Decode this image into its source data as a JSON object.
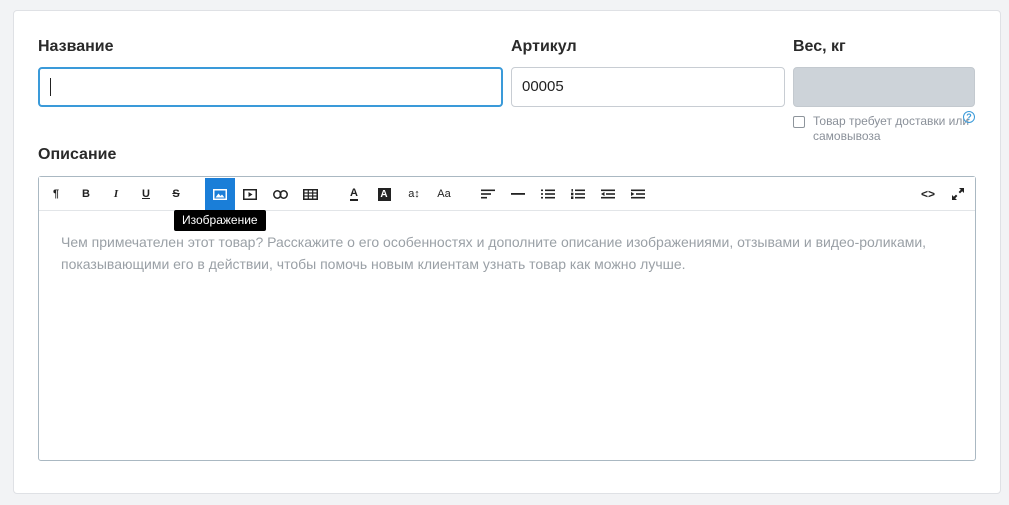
{
  "form": {
    "name": {
      "label": "Название",
      "value": ""
    },
    "sku": {
      "label": "Артикул",
      "value": "00005"
    },
    "weight": {
      "label": "Вес, кг",
      "value": ""
    },
    "delivery_checkbox": {
      "label": "Товар требует доставки или самовывоза",
      "checked": false
    },
    "help_icon": "question-circle-icon",
    "description": {
      "label": "Описание",
      "placeholder": "Чем примечателен этот товар? Расскажите о его особенностях и дополните описание изображениями, отзывами и видео-роликами, показывающими его в действии, чтобы помочь новым клиентам узнать товар как можно лучше."
    }
  },
  "toolbar": {
    "buttons": [
      {
        "icon": "paragraph-icon",
        "text": "¶"
      },
      {
        "icon": "bold-icon",
        "text": "B"
      },
      {
        "icon": "italic-icon",
        "text": "I"
      },
      {
        "icon": "underline-icon",
        "text": "U"
      },
      {
        "icon": "strikethrough-icon",
        "text": "S"
      },
      {
        "icon": "image-icon",
        "active": true
      },
      {
        "icon": "video-icon"
      },
      {
        "icon": "link-icon"
      },
      {
        "icon": "table-icon"
      },
      {
        "icon": "font-color-icon",
        "text": "A"
      },
      {
        "icon": "background-color-icon",
        "text": "A"
      },
      {
        "icon": "font-size-icon",
        "text": "a↕"
      },
      {
        "icon": "text-case-icon",
        "text": "Aa"
      },
      {
        "icon": "align-left-icon"
      },
      {
        "icon": "horizontal-rule-icon"
      },
      {
        "icon": "bullet-list-icon"
      },
      {
        "icon": "numbered-list-icon"
      },
      {
        "icon": "outdent-icon"
      },
      {
        "icon": "indent-icon"
      },
      {
        "icon": "code-view-icon",
        "text": "<>"
      },
      {
        "icon": "fullscreen-icon"
      }
    ],
    "tooltip": "Изображение"
  },
  "colors": {
    "accent": "#1a7ed8",
    "focus_border": "#3a9ad9",
    "disabled_bg": "#cdd3d9"
  }
}
